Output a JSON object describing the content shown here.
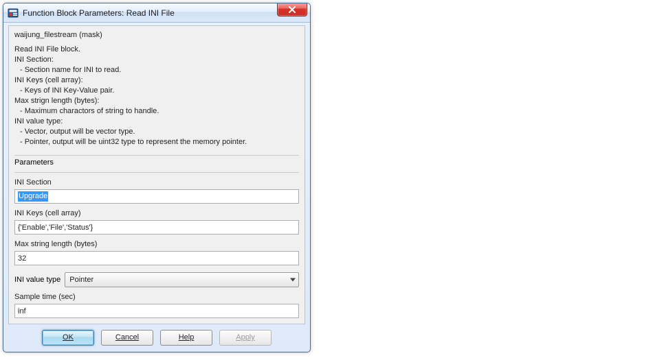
{
  "window": {
    "title": "Function Block Parameters: Read INI File"
  },
  "description": {
    "mask_line": "waijung_filestream (mask)",
    "lines": [
      "Read INI File block.",
      "INI Section:",
      " - Section name for INI to read.",
      "INI Keys (cell array):",
      " - Keys of INI Key-Value pair.",
      "Max strign length (bytes):",
      " - Maximum charactors of string to handle.",
      "INI value type:",
      " - Vector, output will be vector type.",
      " - Pointer, output will be uint32 type to represent the memory pointer."
    ]
  },
  "params": {
    "heading": "Parameters",
    "ini_section": {
      "label": "INI Section",
      "value": "Upgrade"
    },
    "ini_keys": {
      "label": "INI Keys (cell array)",
      "value": "{'Enable','File','Status'}"
    },
    "max_len": {
      "label": "Max string length (bytes)",
      "value": "32"
    },
    "value_type": {
      "label": "INI value type",
      "selected": "Pointer"
    },
    "sample_time": {
      "label": "Sample time (sec)",
      "value": "inf"
    }
  },
  "buttons": {
    "ok": "OK",
    "cancel": "Cancel",
    "help": "Help",
    "apply": "Apply"
  }
}
